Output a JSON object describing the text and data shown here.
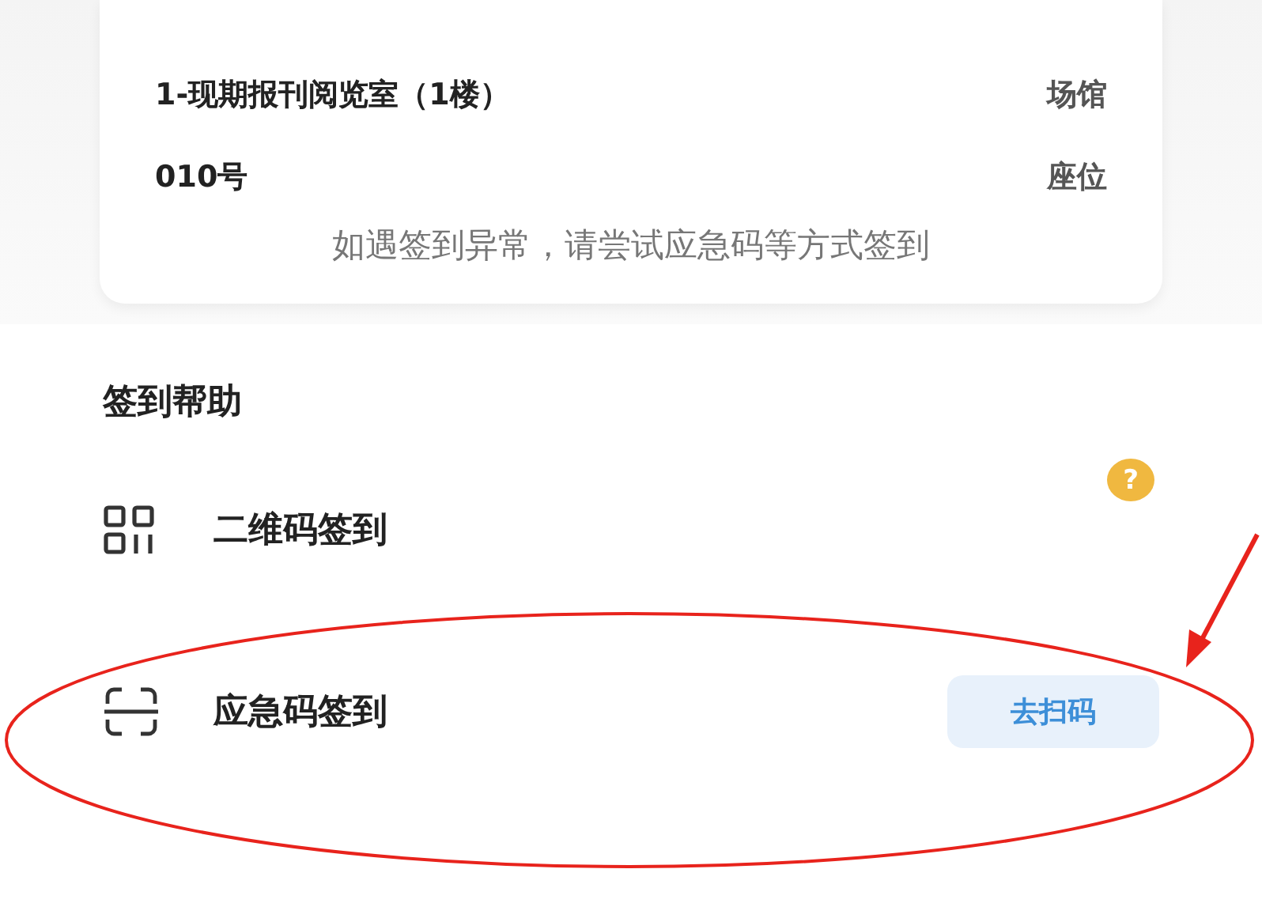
{
  "seat_card": {
    "rows": [
      {
        "value": "1-现期报刊阅览室（1楼）",
        "label": "场馆"
      },
      {
        "value": "010号",
        "label": "座位"
      }
    ],
    "note": "如遇签到异常，请尝试应急码等方式签到"
  },
  "help": {
    "title": "签到帮助",
    "items": [
      {
        "kind": "qr",
        "label": "二维码签到",
        "badge": "?"
      },
      {
        "kind": "scan",
        "label": "应急码签到",
        "button": "去扫码"
      }
    ]
  }
}
